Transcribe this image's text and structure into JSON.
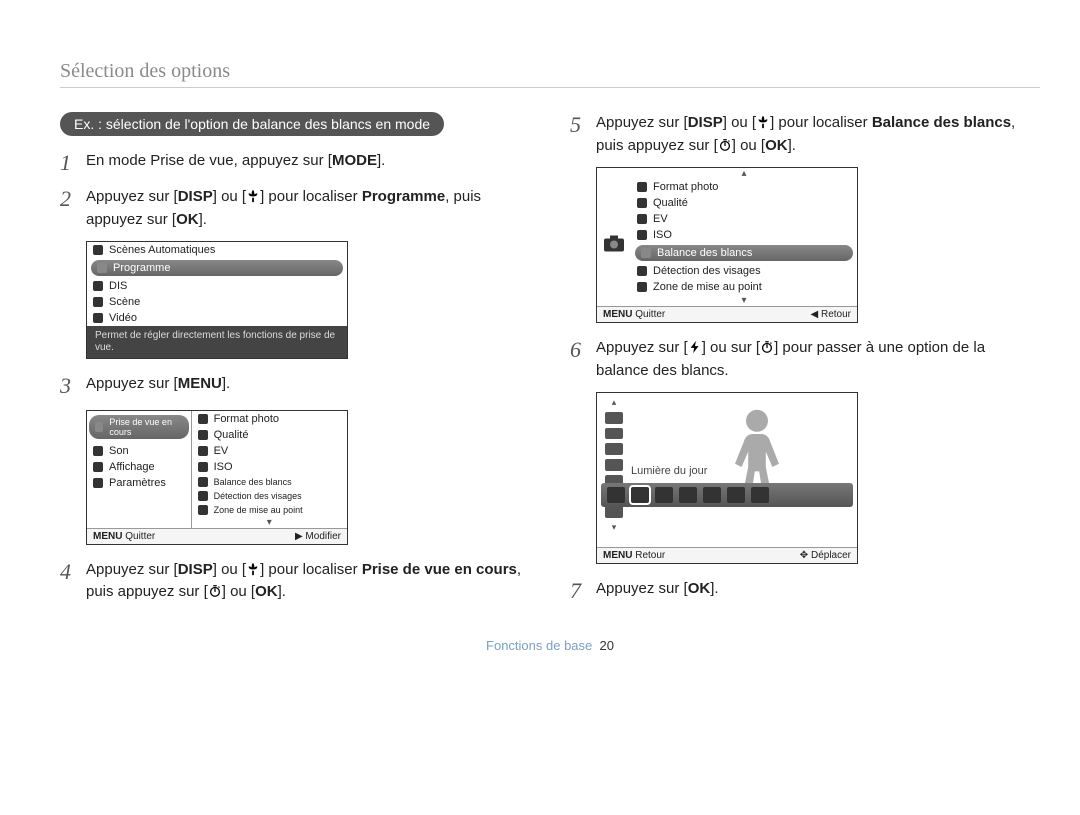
{
  "header": "Sélection des options",
  "example_pill": "Ex. : sélection de l'option de balance des blancs en mode",
  "steps": {
    "s1": {
      "num": "1",
      "pre": "En mode Prise de vue, appuyez sur [",
      "btn": "MODE",
      "post": "]."
    },
    "s2": {
      "num": "2",
      "pre": "Appuyez sur [",
      "btn1": "DISP",
      "mid1": "] ou [",
      "mid2": "] pour localiser ",
      "bold": "Programme",
      "post": ", puis appuyez sur [",
      "btn2": "OK",
      "end": "]."
    },
    "s3": {
      "num": "3",
      "pre": "Appuyez sur [",
      "btn": "MENU",
      "post": "]."
    },
    "s4": {
      "num": "4",
      "pre": "Appuyez sur [",
      "btn1": "DISP",
      "mid1": "] ou [",
      "mid2": "] pour localiser ",
      "bold": "Prise de vue en cours",
      "post": ", puis appuyez sur [",
      "mid3": "] ou [",
      "btn2": "OK",
      "end": "]."
    },
    "s5": {
      "num": "5",
      "pre": "Appuyez sur [",
      "btn1": "DISP",
      "mid1": "] ou [",
      "mid2": "] pour localiser ",
      "bold": "Balance des blancs",
      "post": ", puis appuyez sur [",
      "mid3": "] ou [",
      "btn2": "OK",
      "end": "]."
    },
    "s6": {
      "num": "6",
      "pre": "Appuyez sur [",
      "mid1": "] ou sur [",
      "mid2": "] pour passer à une option de la balance des blancs."
    },
    "s7": {
      "num": "7",
      "pre": "Appuyez sur [",
      "btn": "OK",
      "post": "]."
    }
  },
  "screen1": {
    "items": [
      "Scènes Automatiques",
      "Programme",
      "DIS",
      "Scène",
      "Vidéo"
    ],
    "hint": "Permet de régler directement les fonctions de prise de vue."
  },
  "screen2": {
    "left": [
      "Prise de vue en cours",
      "Son",
      "Affichage",
      "Paramètres"
    ],
    "right": [
      "Format photo",
      "Qualité",
      "EV",
      "ISO",
      "Balance des blancs",
      "Détection des visages",
      "Zone de mise au point"
    ],
    "footer_left_label": "Quitter",
    "footer_left_btn": "MENU",
    "footer_right_label": "Modifier",
    "footer_right_sym": "▶"
  },
  "screen3": {
    "items": [
      "Format photo",
      "Qualité",
      "EV",
      "ISO",
      "Balance des blancs",
      "Détection des visages",
      "Zone de mise au point"
    ],
    "footer_left_label": "Quitter",
    "footer_left_btn": "MENU",
    "footer_right_label": "Retour",
    "footer_right_sym": "◀"
  },
  "screen4": {
    "label": "Lumière du jour",
    "footer_left_label": "Retour",
    "footer_left_btn": "MENU",
    "footer_right_label": "Déplacer",
    "footer_right_sym": "✥"
  },
  "footer": {
    "section": "Fonctions de base",
    "page": "20"
  }
}
